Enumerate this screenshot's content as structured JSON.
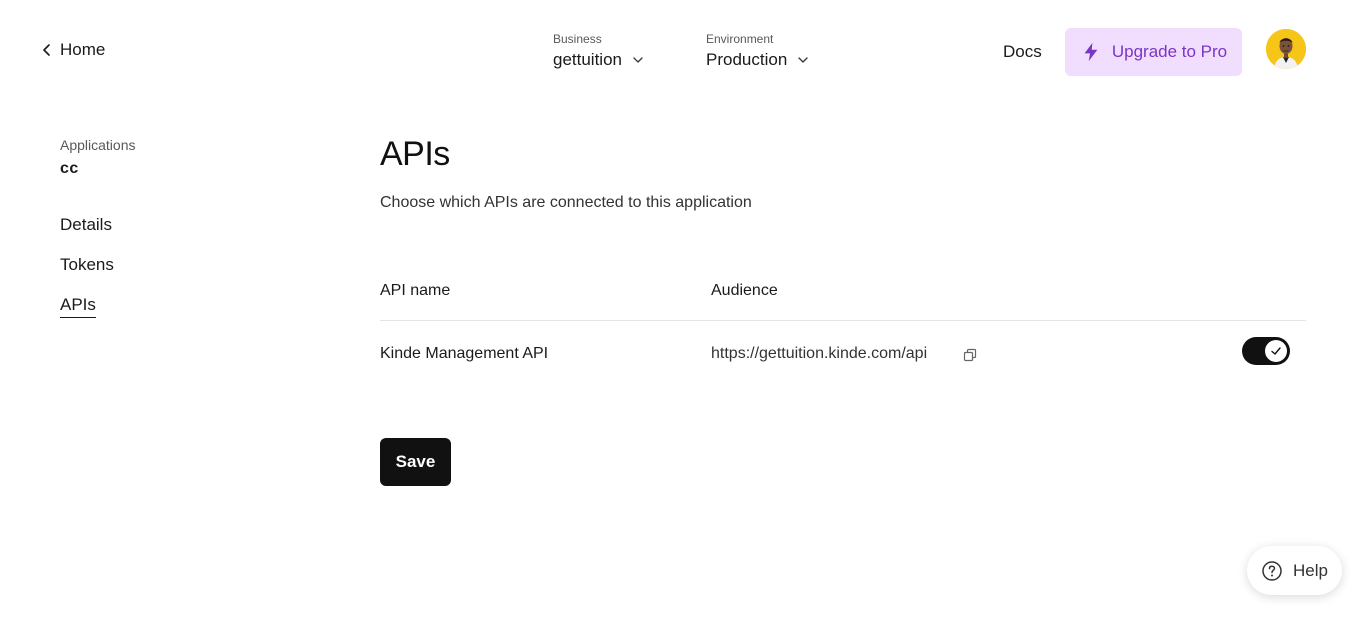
{
  "header": {
    "home_label": "Home",
    "business": {
      "label": "Business",
      "value": "gettuition"
    },
    "environment": {
      "label": "Environment",
      "value": "Production"
    },
    "docs_label": "Docs",
    "upgrade_label": "Upgrade to Pro"
  },
  "sidebar": {
    "crumb": "Applications",
    "app_name": "cc",
    "items": [
      {
        "label": "Details"
      },
      {
        "label": "Tokens"
      },
      {
        "label": "APIs",
        "active": true
      }
    ]
  },
  "main": {
    "title": "APIs",
    "description": "Choose which APIs are connected to this application",
    "columns": [
      "API name",
      "Audience"
    ],
    "rows": [
      {
        "name": "Kinde Management API",
        "audience": "https://gettuition.kinde.com/api",
        "enabled": true
      }
    ],
    "save_label": "Save"
  },
  "help_label": "Help",
  "colors": {
    "upgrade_bg": "#f1deff",
    "upgrade_text": "#7b35c4",
    "primary": "#111111",
    "avatar_bg": "#f5c518"
  }
}
